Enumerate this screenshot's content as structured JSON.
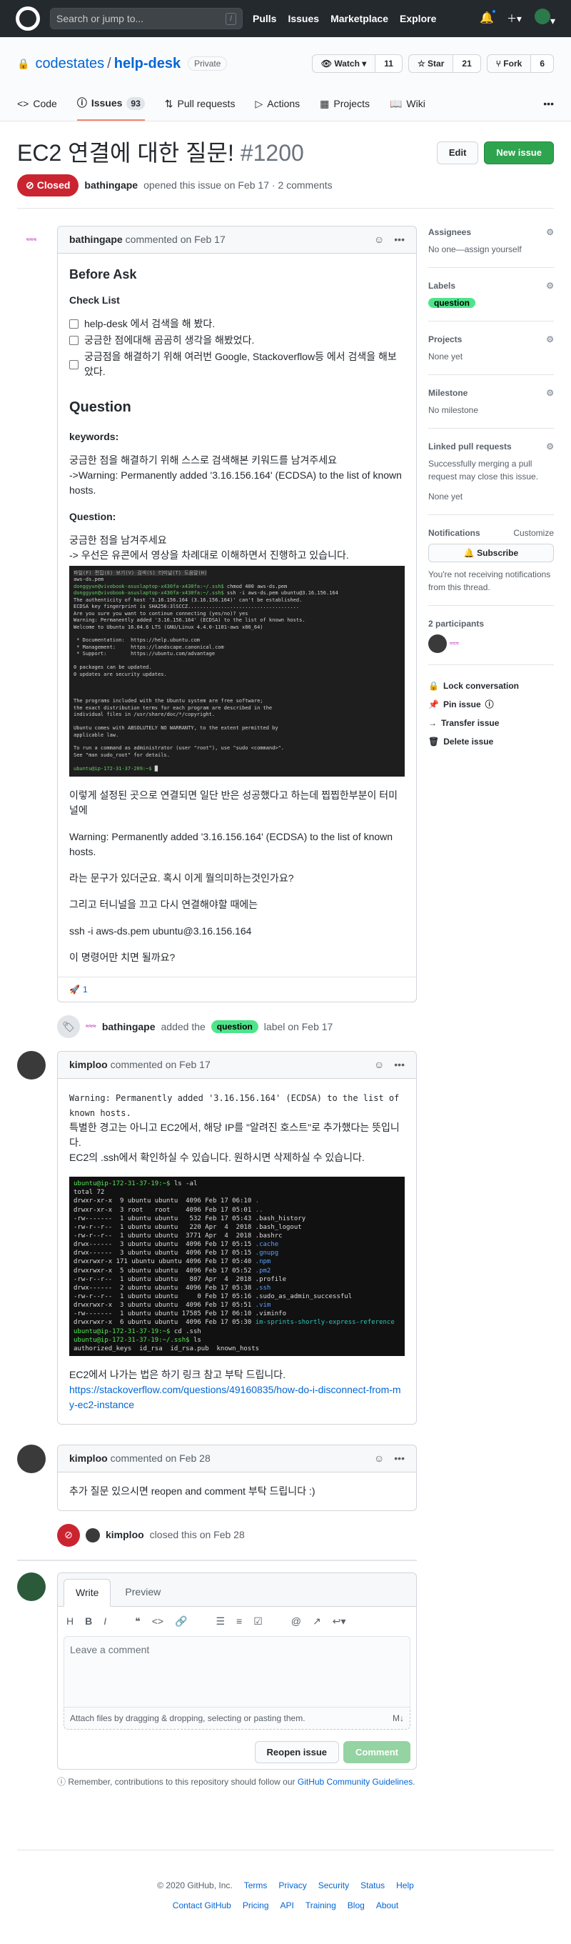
{
  "header": {
    "search_placeholder": "Search or jump to...",
    "search_key": "/",
    "nav": [
      "Pulls",
      "Issues",
      "Marketplace",
      "Explore"
    ]
  },
  "repo": {
    "owner": "codestates",
    "name": "help-desk",
    "visibility": "Private",
    "watch": "Watch",
    "watch_count": "11",
    "star": "Star",
    "star_count": "21",
    "fork": "Fork",
    "fork_count": "6",
    "tabs": [
      {
        "label": "Code"
      },
      {
        "label": "Issues",
        "count": "93"
      },
      {
        "label": "Pull requests"
      },
      {
        "label": "Actions"
      },
      {
        "label": "Projects"
      },
      {
        "label": "Wiki"
      }
    ]
  },
  "issue": {
    "title": "EC2 연결에 대한 질문!",
    "number": "#1200",
    "state": "Closed",
    "author": "bathingape",
    "meta": "opened this issue on Feb 17 · 2 comments",
    "edit": "Edit",
    "new_issue": "New issue"
  },
  "comments": [
    {
      "author": "bathingape",
      "date": "commented on Feb 17",
      "h_before": "Before Ask",
      "h_check": "Check List",
      "tasks": [
        "help-desk 에서 검색을 해 봤다.",
        "궁금한 점에대해 곰곰히 생각을 해봤었다.",
        "궁금점을 해결하기 위해 여러번 Google, Stackoverflow등 에서 검색을 해보았다."
      ],
      "h_question": "Question",
      "h_keywords": "keywords:",
      "kw_text": "궁금한 점을 해결하기 위해 스스로 검색해본 키워드를 남겨주세요\n->Warning: Permanently added '3.16.156.164' (ECDSA) to the list of known hosts.",
      "h_q2": "Question:",
      "q_text": "궁금한 점을 남겨주세요\n-> 우선은 유콘에서 영상을 차례대로 이해하면서 진행하고 있습니다.",
      "p1": "이렇게 설정된 곳으로 연결되면 일단 반은 성공했다고 하는데 찝찝한부분이 터미널에",
      "p2": "Warning: Permanently added '3.16.156.164' (ECDSA) to the list of known hosts.",
      "p3": "라는 문구가 있더군요. 혹시 이게 뭘의미하는것인가요?",
      "p4": "그리고 터니널을 끄고 다시 연결해야할 때에는",
      "p5": "ssh -i aws-ds.pem ubuntu@3.16.156.164",
      "p6": "이 명령어만 치면 될까요?",
      "reaction_count": "1"
    },
    {
      "author": "kimploo",
      "date": "commented on Feb 17",
      "code": "Warning: Permanently added '3.16.156.164' (ECDSA) to the list of known hosts.",
      "p1": "특별한 경고는 아니고 EC2에서, 해당 IP를 \"알려진 호스트\"로 추가했다는 뜻입니다.",
      "p2": "EC2의 .ssh에서 확인하실 수 있습니다. 원하시면 삭제하실 수 있습니다.",
      "p3": "EC2에서 나가는 법은 하기 링크 참고 부탁 드립니다.",
      "link": "https://stackoverflow.com/questions/49160835/how-do-i-disconnect-from-my-ec2-instance"
    },
    {
      "author": "kimploo",
      "date": "commented on Feb 28",
      "p1": "추가 질문 있으시면 reopen and comment 부탁 드립니다 :)"
    }
  ],
  "events": {
    "label_actor": "bathingape",
    "label_text_a": "added the",
    "label_name": "question",
    "label_text_b": "label on Feb 17",
    "closed_actor": "kimploo",
    "closed_text": "closed this on Feb 28"
  },
  "composer": {
    "tab_write": "Write",
    "tab_preview": "Preview",
    "placeholder": "Leave a comment",
    "attach": "Attach files by dragging & dropping, selecting or pasting them.",
    "reopen": "Reopen issue",
    "comment": "Comment",
    "tip_a": "Remember, contributions to this repository should follow our ",
    "tip_link": "GitHub Community Guidelines",
    "tip_b": "."
  },
  "sidebar": {
    "assignees_h": "Assignees",
    "assignees_v": "No one—assign yourself",
    "labels_h": "Labels",
    "label": "question",
    "projects_h": "Projects",
    "projects_v": "None yet",
    "milestone_h": "Milestone",
    "milestone_v": "No milestone",
    "linked_h": "Linked pull requests",
    "linked_desc": "Successfully merging a pull request may close this issue.",
    "linked_v": "None yet",
    "notif_h": "Notifications",
    "customize": "Customize",
    "subscribe": "Subscribe",
    "notif_desc": "You're not receiving notifications from this thread.",
    "participants": "2 participants",
    "lock": "Lock conversation",
    "pin": "Pin issue",
    "transfer": "Transfer issue",
    "delete": "Delete issue"
  },
  "footer": {
    "copyright": "© 2020 GitHub, Inc.",
    "row1": [
      "Terms",
      "Privacy",
      "Security",
      "Status",
      "Help"
    ],
    "row2": [
      "Contact GitHub",
      "Pricing",
      "API",
      "Training",
      "Blog",
      "About"
    ]
  }
}
